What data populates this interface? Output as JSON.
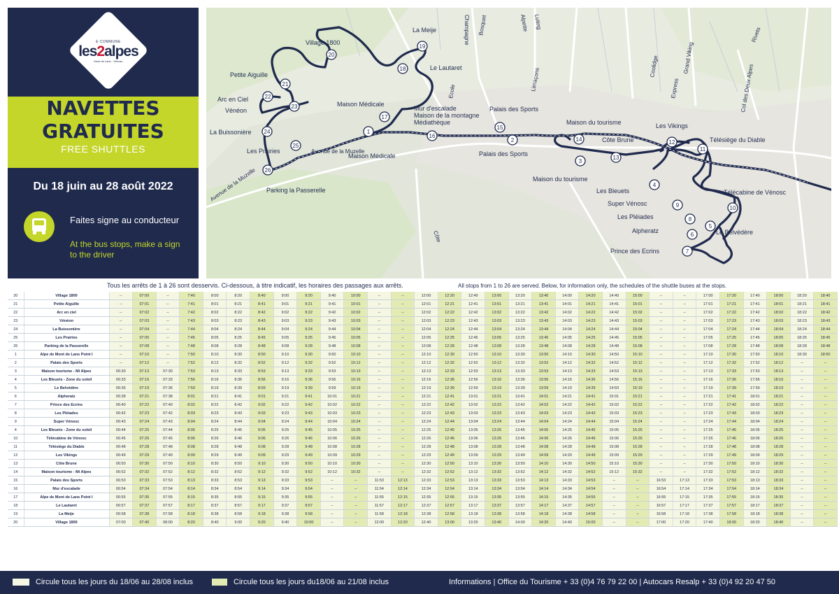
{
  "brand": {
    "small": "E COMMUNE",
    "name_a": "les",
    "name_b": "2",
    "name_c": "alpes",
    "sub": "Mont de Lans · Vénosc"
  },
  "title": {
    "line1": "NAVETTES",
    "line2": "GRATUITES",
    "en": "FREE SHUTTLES"
  },
  "dates": "Du 18 juin au 28 août 2022",
  "sign": {
    "fr": "Faites signe au conducteur",
    "en": "At the bus stops, make a sign to the driver"
  },
  "note": {
    "fr": "Tous les arrêts de 1 à 26 sont desservis. Ci-dessous, à titre indicatif, les horaires des passages aux arrêts.",
    "en": "All stops from 1 to 26 are served. Below, for information only, the schedules of the shuttle buses at the stops."
  },
  "map": {
    "stops": [
      {
        "n": "1",
        "label": "Maison Médicale"
      },
      {
        "n": "2",
        "label": "Palais des Sports"
      },
      {
        "n": "3",
        "label": "Maison du tourisme"
      },
      {
        "n": "4",
        "label": "Les Bleuets"
      },
      {
        "n": "5",
        "label": "Le Belvédère"
      },
      {
        "n": "6",
        "label": "Alpheratz"
      },
      {
        "n": "7",
        "label": "Prince des Ecrins"
      },
      {
        "n": "8",
        "label": "Les Pléiades"
      },
      {
        "n": "9",
        "label": "Super Vénosc"
      },
      {
        "n": "10",
        "label": "Télécabine de Vénosc"
      },
      {
        "n": "11",
        "label": "Télésiège du Diable"
      },
      {
        "n": "12",
        "label": "Les Vikings"
      },
      {
        "n": "13",
        "label": "Côte Brune"
      },
      {
        "n": "14",
        "label": "Maison du tourisme"
      },
      {
        "n": "15",
        "label": "Palais des Sports"
      },
      {
        "n": "16",
        "label": "Mur d'escalade\nMaison de la montagne\nMédiathèque"
      },
      {
        "n": "17",
        "label": "Maison Médicale"
      },
      {
        "n": "18",
        "label": "Le Lautaret"
      },
      {
        "n": "19",
        "label": "La Meije"
      },
      {
        "n": "20",
        "label": "Village 1800"
      },
      {
        "n": "21",
        "label": "Petite Aiguille"
      },
      {
        "n": "22",
        "label": "Arc en Ciel"
      },
      {
        "n": "23",
        "label": "Vénéon"
      },
      {
        "n": "24",
        "label": "La Buissonière"
      },
      {
        "n": "25",
        "label": "Les Prairies"
      },
      {
        "n": "26",
        "label": "Parking la Passerelle"
      }
    ],
    "streets": [
      "Avenue de la Muzelle",
      "Avenue de la Muzelle",
      "Côte",
      "Champagne",
      "Bosquet",
      "Alpette",
      "Luting",
      "Grand Viking",
      "Rivets",
      "Col des Deux Alpes",
      "Coolidge",
      "Express",
      "Limaçons",
      "Ecole"
    ]
  },
  "table": {
    "rows": [
      [
        "20",
        "Village 1800",
        "--",
        "07:00",
        "--",
        "7:40",
        "8:00",
        "8:20",
        "8:40",
        "9:00",
        "9:20",
        "9:40",
        "10:00",
        "--",
        "--",
        "12:00",
        "12:20",
        "12:40",
        "13:00",
        "13:20",
        "13:40",
        "14:00",
        "14:20",
        "14:40",
        "15:00",
        "--",
        "--",
        "17:00",
        "17:20",
        "17:40",
        "18:00",
        "18:20",
        "18:40"
      ],
      [
        "21",
        "Petite Aiguille",
        "--",
        "07:01",
        "--",
        "7:41",
        "8:01",
        "8:21",
        "8:41",
        "9:01",
        "9:21",
        "9:41",
        "10:01",
        "--",
        "--",
        "12:01",
        "12:21",
        "12:41",
        "13:01",
        "13:21",
        "13:41",
        "14:01",
        "14:21",
        "14:41",
        "15:01",
        "--",
        "--",
        "17:01",
        "17:21",
        "17:41",
        "18:01",
        "18:21",
        "18:41"
      ],
      [
        "22",
        "Arc en ciel",
        "--",
        "07:02",
        "--",
        "7:42",
        "8:02",
        "8:22",
        "8:42",
        "9:02",
        "9:22",
        "9:42",
        "10:02",
        "--",
        "--",
        "12:02",
        "12:22",
        "12:42",
        "13:02",
        "13:22",
        "13:42",
        "14:02",
        "14:22",
        "14:42",
        "15:02",
        "--",
        "--",
        "17:02",
        "17:22",
        "17:42",
        "18:02",
        "18:22",
        "18:42"
      ],
      [
        "23",
        "Vénéon",
        "--",
        "07:03",
        "--",
        "7:43",
        "8:03",
        "8:23",
        "8:43",
        "9:03",
        "9:23",
        "9:43",
        "10:03",
        "--",
        "--",
        "12:03",
        "12:23",
        "12:43",
        "13:03",
        "13:23",
        "13:43",
        "14:03",
        "14:23",
        "14:43",
        "15:03",
        "--",
        "--",
        "17:03",
        "17:23",
        "17:43",
        "18:03",
        "18:23",
        "18:43"
      ],
      [
        "24",
        "La Buissonière",
        "--",
        "07:04",
        "--",
        "7:44",
        "8:04",
        "8:24",
        "8:44",
        "9:04",
        "9:24",
        "9:44",
        "10:04",
        "--",
        "--",
        "12:04",
        "12:24",
        "12:44",
        "13:04",
        "13:24",
        "13:44",
        "14:04",
        "14:24",
        "14:44",
        "15:04",
        "--",
        "--",
        "17:04",
        "17:24",
        "17:44",
        "18:04",
        "18:24",
        "18:44"
      ],
      [
        "25",
        "Les Prairies",
        "--",
        "07:05",
        "--",
        "7:45",
        "8:05",
        "8:25",
        "8:45",
        "9:05",
        "9:25",
        "9:45",
        "10:05",
        "--",
        "--",
        "12:05",
        "12:25",
        "12:45",
        "13:05",
        "13:25",
        "13:45",
        "14:05",
        "14:25",
        "14:45",
        "15:05",
        "--",
        "--",
        "17:05",
        "17:25",
        "17:45",
        "18:05",
        "18:25",
        "18:45"
      ],
      [
        "26",
        "Parking de la Passerelle",
        "--",
        "07:08",
        "--",
        "7:48",
        "8:08",
        "8:28",
        "8:48",
        "9:08",
        "9:28",
        "9:48",
        "10:08",
        "--",
        "--",
        "12:08",
        "12:28",
        "12:48",
        "13:08",
        "13:28",
        "13:48",
        "14:08",
        "14:28",
        "14:48",
        "15:08",
        "--",
        "--",
        "17:08",
        "17:28",
        "17:48",
        "18:08",
        "18:28",
        "18:48"
      ],
      [
        "1",
        "Alpe de Mont de Lans Point I",
        "--",
        "07:10",
        "--",
        "7:50",
        "8:10",
        "8:30",
        "8:50",
        "9:10",
        "9:30",
        "9:50",
        "10:10",
        "--",
        "--",
        "12:10",
        "12:30",
        "12:50",
        "13:10",
        "13:30",
        "13:50",
        "14:10",
        "14:30",
        "14:50",
        "15:10",
        "--",
        "--",
        "17:10",
        "17:30",
        "17:50",
        "18:10",
        "18:30",
        "18:50"
      ],
      [
        "2",
        "Palais des Sports",
        "--",
        "07:12",
        "--",
        "7:52",
        "8:12",
        "8:32",
        "8:52",
        "9:12",
        "9:32",
        "9:52",
        "10:12",
        "--",
        "--",
        "12:12",
        "12:32",
        "12:52",
        "13:12",
        "13:32",
        "13:52",
        "14:12",
        "14:32",
        "14:52",
        "15:12",
        "--",
        "--",
        "17:12",
        "17:32",
        "17:52",
        "18:12",
        "--",
        "--"
      ],
      [
        "3",
        "Maison tourisme - Mi Alpes",
        "06:30",
        "07:13",
        "07:30",
        "7:53",
        "8:13",
        "8:33",
        "8:53",
        "9:13",
        "9:33",
        "9:53",
        "10:13",
        "--",
        "--",
        "12:13",
        "12:33",
        "12:53",
        "13:13",
        "13:33",
        "13:53",
        "14:13",
        "14:33",
        "14:53",
        "15:13",
        "--",
        "--",
        "17:13",
        "17:33",
        "17:53",
        "18:13",
        "--",
        "--"
      ],
      [
        "4",
        "Les Bleuets - Zone du soleil",
        "06:33",
        "07:16",
        "07:33",
        "7:56",
        "8:16",
        "8:36",
        "8:56",
        "9:16",
        "9:36",
        "9:56",
        "10:16",
        "--",
        "--",
        "12:16",
        "12:36",
        "12:56",
        "13:16",
        "13:36",
        "13:56",
        "14:16",
        "14:36",
        "14:56",
        "15:16",
        "--",
        "--",
        "17:16",
        "17:36",
        "17:56",
        "18:16",
        "--",
        "--"
      ],
      [
        "5",
        "Le Belvédère",
        "06:36",
        "07:19",
        "07:36",
        "7:59",
        "8:19",
        "8:39",
        "8:59",
        "9:19",
        "9:39",
        "9:59",
        "10:19",
        "--",
        "--",
        "12:19",
        "12:39",
        "12:59",
        "13:19",
        "13:39",
        "13:59",
        "14:19",
        "14:39",
        "14:59",
        "15:19",
        "--",
        "--",
        "17:19",
        "17:39",
        "17:59",
        "18:19",
        "--",
        "--"
      ],
      [
        "6",
        "Alpheratz",
        "06:38",
        "07:21",
        "07:38",
        "8:01",
        "8:21",
        "8:41",
        "9:01",
        "9:21",
        "9:41",
        "10:01",
        "10:21",
        "--",
        "--",
        "12:21",
        "12:41",
        "13:01",
        "13:21",
        "13:41",
        "14:01",
        "14:21",
        "14:41",
        "15:01",
        "15:21",
        "--",
        "--",
        "17:21",
        "17:41",
        "18:01",
        "18:21",
        "--",
        "--"
      ],
      [
        "7",
        "Prince des Ecrins",
        "06:40",
        "07:22",
        "07:40",
        "8:02",
        "8:22",
        "8:42",
        "9:02",
        "9:22",
        "9:42",
        "10:02",
        "10:22",
        "--",
        "--",
        "12:22",
        "12:42",
        "13:02",
        "13:22",
        "13:42",
        "14:02",
        "14:22",
        "14:42",
        "15:02",
        "15:22",
        "--",
        "--",
        "17:22",
        "17:42",
        "18:02",
        "18:22",
        "--",
        "--"
      ],
      [
        "8",
        "Les Pléiades",
        "06:42",
        "07:23",
        "07:42",
        "8:03",
        "8:23",
        "8:43",
        "9:03",
        "9:23",
        "9:43",
        "10:03",
        "10:23",
        "--",
        "--",
        "12:23",
        "12:43",
        "13:03",
        "13:23",
        "13:43",
        "14:03",
        "14:23",
        "14:43",
        "15:03",
        "15:23",
        "--",
        "--",
        "17:23",
        "17:43",
        "18:03",
        "18:23",
        "--",
        "--"
      ],
      [
        "9",
        "Super Vénosc",
        "06:43",
        "07:24",
        "07:43",
        "8:04",
        "8:24",
        "8:44",
        "9:04",
        "9:24",
        "9:44",
        "10:04",
        "10:24",
        "--",
        "--",
        "12:24",
        "12:44",
        "13:04",
        "13:24",
        "13:44",
        "14:04",
        "14:24",
        "14:44",
        "15:04",
        "15:24",
        "--",
        "--",
        "17:24",
        "17:44",
        "18:04",
        "18:24",
        "--",
        "--"
      ],
      [
        "4",
        "Les Bleuets - Zone du soleil",
        "06:44",
        "07:25",
        "07:44",
        "8:05",
        "8:25",
        "8:45",
        "9:05",
        "9:25",
        "9:45",
        "10:05",
        "10:25",
        "--",
        "--",
        "12:25",
        "12:45",
        "13:05",
        "13:25",
        "13:45",
        "14:05",
        "14:25",
        "14:45",
        "15:05",
        "15:25",
        "--",
        "--",
        "17:25",
        "17:45",
        "18:05",
        "18:25",
        "--",
        "--"
      ],
      [
        "10",
        "Télécabine de Vénosc",
        "06:45",
        "07:26",
        "07:45",
        "8:06",
        "8:26",
        "8:46",
        "9:06",
        "9:26",
        "9:46",
        "10:06",
        "10:26",
        "--",
        "--",
        "12:26",
        "12:46",
        "13:06",
        "13:26",
        "13:46",
        "14:06",
        "14:26",
        "14:46",
        "15:06",
        "15:26",
        "--",
        "--",
        "17:26",
        "17:46",
        "18:06",
        "18:26",
        "--",
        "--"
      ],
      [
        "11",
        "Télésiège du Diable",
        "06:48",
        "07:28",
        "07:48",
        "8:08",
        "8:28",
        "8:48",
        "9:08",
        "9:28",
        "9:48",
        "10:08",
        "10:28",
        "--",
        "--",
        "12:28",
        "12:48",
        "13:08",
        "13:28",
        "13:48",
        "14:08",
        "14:28",
        "14:48",
        "15:08",
        "15:28",
        "--",
        "--",
        "17:28",
        "17:48",
        "18:08",
        "18:28",
        "--",
        "--"
      ],
      [
        "12",
        "Les Vikings",
        "06:49",
        "07:29",
        "07:49",
        "8:09",
        "8:29",
        "8:49",
        "9:09",
        "9:29",
        "9:49",
        "10:09",
        "10:29",
        "--",
        "--",
        "12:29",
        "12:49",
        "13:09",
        "13:29",
        "13:49",
        "14:09",
        "14:29",
        "14:49",
        "15:09",
        "15:29",
        "--",
        "--",
        "17:29",
        "17:49",
        "18:09",
        "18:29",
        "--",
        "--"
      ],
      [
        "13",
        "Côte Brune",
        "06:50",
        "07:30",
        "07:50",
        "8:10",
        "8:30",
        "8:50",
        "9:10",
        "9:30",
        "9:50",
        "10:10",
        "10:30",
        "--",
        "--",
        "12:30",
        "12:50",
        "13:10",
        "13:30",
        "13:50",
        "14:10",
        "14:30",
        "14:50",
        "15:10",
        "15:30",
        "--",
        "--",
        "17:30",
        "17:50",
        "18:10",
        "18:30",
        "--",
        "--"
      ],
      [
        "14",
        "Maison tourisme - Mi Alpes",
        "06:52",
        "07:32",
        "07:52",
        "8:12",
        "8:32",
        "8:52",
        "9:12",
        "9:32",
        "9:52",
        "10:12",
        "10:32",
        "--",
        "--",
        "12:32",
        "12:52",
        "13:12",
        "13:32",
        "13:52",
        "14:12",
        "14:32",
        "14:52",
        "15:12",
        "15:32",
        "--",
        "--",
        "17:32",
        "17:52",
        "18:12",
        "18:32",
        "--",
        "--"
      ],
      [
        "15",
        "Palais des Sports",
        "06:53",
        "07:33",
        "07:53",
        "8:13",
        "8:33",
        "8:53",
        "9:13",
        "9:33",
        "9:53",
        "--",
        "--",
        "11:53",
        "12:13",
        "12:33",
        "12:53",
        "13:13",
        "13:33",
        "13:53",
        "14:13",
        "14:33",
        "14:53",
        "--",
        "--",
        "16:53",
        "17:13",
        "17:33",
        "17:53",
        "18:13",
        "18:33",
        "--",
        "--"
      ],
      [
        "16",
        "Mur d'escalade",
        "06:54",
        "07:34",
        "07:54",
        "8:14",
        "8:34",
        "8:54",
        "9:14",
        "9:34",
        "9:54",
        "--",
        "--",
        "11:54",
        "12:14",
        "12:34",
        "12:54",
        "13:14",
        "13:34",
        "13:54",
        "14:14",
        "14:34",
        "14:54",
        "--",
        "--",
        "16:54",
        "17:14",
        "17:34",
        "17:54",
        "18:14",
        "18:34",
        "--",
        "--"
      ],
      [
        "17",
        "Alpe de Mont de Lans Point I",
        "06:55",
        "07:35",
        "07:55",
        "8:15",
        "8:35",
        "8:55",
        "9:15",
        "9:35",
        "9:55",
        "--",
        "--",
        "11:55",
        "12:15",
        "12:35",
        "12:55",
        "13:15",
        "13:35",
        "13:55",
        "14:15",
        "14:35",
        "14:55",
        "--",
        "--",
        "16:55",
        "17:15",
        "17:35",
        "17:55",
        "18:15",
        "18:35",
        "--",
        "--"
      ],
      [
        "18",
        "Le Lautaret",
        "06:57",
        "07:37",
        "07:57",
        "8:17",
        "8:37",
        "8:57",
        "9:17",
        "9:37",
        "9:57",
        "--",
        "--",
        "11:57",
        "12:17",
        "12:37",
        "12:57",
        "13:17",
        "13:37",
        "13:57",
        "14:17",
        "14:37",
        "14:57",
        "--",
        "--",
        "16:57",
        "17:17",
        "17:37",
        "17:57",
        "18:17",
        "18:37",
        "--",
        "--"
      ],
      [
        "19",
        "La Meije",
        "06:58",
        "07:38",
        "07:58",
        "8:18",
        "8:38",
        "8:58",
        "9:18",
        "9:38",
        "9:58",
        "--",
        "--",
        "11:58",
        "12:18",
        "12:38",
        "12:58",
        "13:18",
        "13:38",
        "13:58",
        "14:18",
        "14:38",
        "14:58",
        "--",
        "--",
        "16:58",
        "17:18",
        "17:38",
        "17:58",
        "18:18",
        "18:38",
        "--",
        "--"
      ],
      [
        "20",
        "Village 1800",
        "07:00",
        "07:40",
        "08:00",
        "8:20",
        "8:40",
        "9:00",
        "9:20",
        "9:40",
        "10:00",
        "--",
        "--",
        "12:00",
        "12:20",
        "12:40",
        "13:00",
        "13:20",
        "13:40",
        "14:00",
        "14:20",
        "14:40",
        "15:00",
        "--",
        "--",
        "17:00",
        "17:20",
        "17:40",
        "18:00",
        "18:20",
        "18:40",
        "--",
        "--"
      ]
    ]
  },
  "footer": {
    "legend1": "Circule tous les jours du 18/06 au 28/08 inclus",
    "legend2": "Circule tous les jours du18/06 au 21/08 inclus",
    "contact": "Informations  |  Office du Tourisme + 33 (0)4 76 79 22 00  |  Autocars Resalp + 33 (0)4 92 20 47 50"
  },
  "colors": {
    "navy": "#1f2a4d",
    "lime": "#c4d62a",
    "light_col": "#f5f7e2",
    "green_col": "#e3ebb2"
  }
}
